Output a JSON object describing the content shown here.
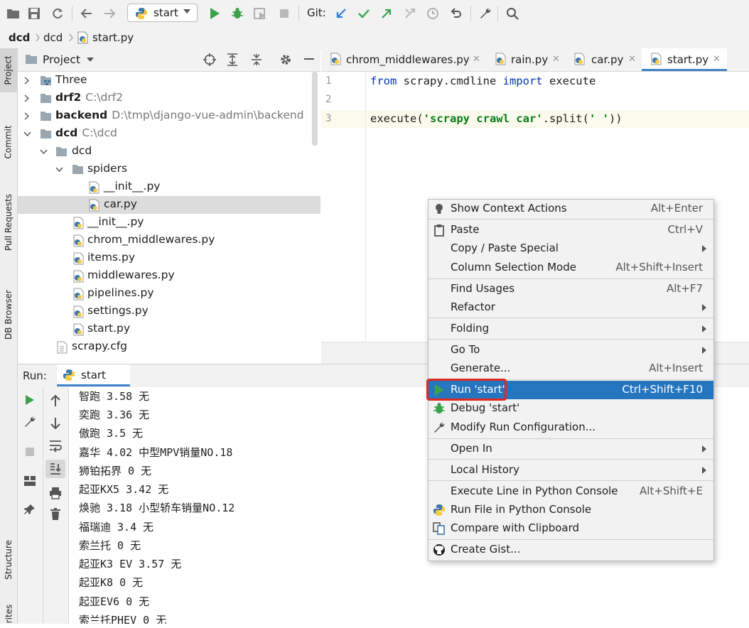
{
  "toolbar": {
    "run_config": "start",
    "git_label": "Git:"
  },
  "breadcrumb": [
    "dcd",
    "dcd",
    "start.py"
  ],
  "left_strip": [
    "Project",
    "Commit",
    "Pull Requests",
    "DB Browser",
    "Structure",
    "rites"
  ],
  "project": {
    "header": "Project",
    "tree": [
      {
        "name": "Three",
        "path": "",
        "bold": false
      },
      {
        "name": "drf2",
        "path": "C:\\drf2",
        "bold": true
      },
      {
        "name": "backend",
        "path": "D:\\tmp\\django-vue-admin\\backend",
        "bold": true
      },
      {
        "name": "dcd",
        "path": "C:\\dcd",
        "bold": true
      },
      {
        "name": "dcd",
        "path": "",
        "bold": false
      },
      {
        "name": "spiders",
        "path": "",
        "bold": false
      },
      {
        "name": "__init__.py",
        "path": "",
        "bold": false
      },
      {
        "name": "car.py",
        "path": "",
        "bold": false
      },
      {
        "name": "__init__.py",
        "path": "",
        "bold": false
      },
      {
        "name": "chrom_middlewares.py",
        "path": "",
        "bold": false
      },
      {
        "name": "items.py",
        "path": "",
        "bold": false
      },
      {
        "name": "middlewares.py",
        "path": "",
        "bold": false
      },
      {
        "name": "pipelines.py",
        "path": "",
        "bold": false
      },
      {
        "name": "settings.py",
        "path": "",
        "bold": false
      },
      {
        "name": "start.py",
        "path": "",
        "bold": false
      },
      {
        "name": "scrapy.cfg",
        "path": "",
        "bold": false
      }
    ]
  },
  "editor": {
    "tabs": [
      "chrom_middlewares.py",
      "rain.py",
      "car.py",
      "start.py"
    ],
    "active_tab": "start.py",
    "line_numbers": [
      "1",
      "2",
      "3"
    ],
    "line1": {
      "kw1": "from",
      "mod": " scrapy.cmdline ",
      "kw2": "import",
      "rest": " execute"
    },
    "line3": {
      "pre": "execute(",
      "str1": "'scrapy crawl car'",
      "mid": ".split(",
      "str2": "' '",
      "post": "))"
    }
  },
  "run": {
    "label": "Run:",
    "tab": "start",
    "output": [
      "智跑 3.58 无",
      "奕跑 3.36 无",
      "傲跑 3.5 无",
      "嘉华 4.02 中型MPV销量NO.18",
      "狮铂拓界 0 无",
      "起亚KX5 3.42 无",
      "焕驰 3.18 小型轿车销量NO.12",
      "福瑞迪 3.4 无",
      "索兰托 0 无",
      "起亚K3 EV 3.57 无",
      "起亚K8 0 无",
      "起亚EV6 0 无",
      "索兰托PHEV 0 无"
    ]
  },
  "context_menu": {
    "items": [
      {
        "label": "Show Context Actions",
        "shortcut": "Alt+Enter",
        "submenu": false,
        "icon": "bulb-icon"
      },
      {
        "label": "Paste",
        "shortcut": "Ctrl+V",
        "submenu": false,
        "icon": "clipboard-icon"
      },
      {
        "label": "Copy / Paste Special",
        "shortcut": "",
        "submenu": true,
        "icon": ""
      },
      {
        "label": "Column Selection Mode",
        "shortcut": "Alt+Shift+Insert",
        "submenu": false,
        "icon": ""
      },
      {
        "label": "Find Usages",
        "shortcut": "Alt+F7",
        "submenu": false,
        "icon": ""
      },
      {
        "label": "Refactor",
        "shortcut": "",
        "submenu": true,
        "icon": ""
      },
      {
        "label": "Folding",
        "shortcut": "",
        "submenu": true,
        "icon": ""
      },
      {
        "label": "Go To",
        "shortcut": "",
        "submenu": true,
        "icon": ""
      },
      {
        "label": "Generate...",
        "shortcut": "Alt+Insert",
        "submenu": false,
        "icon": ""
      },
      {
        "label": "Run 'start'",
        "shortcut": "Ctrl+Shift+F10",
        "submenu": false,
        "icon": "run-icon"
      },
      {
        "label": "Debug 'start'",
        "shortcut": "",
        "submenu": false,
        "icon": "debug-icon"
      },
      {
        "label": "Modify Run Configuration...",
        "shortcut": "",
        "submenu": false,
        "icon": "wrench-icon"
      },
      {
        "label": "Open In",
        "shortcut": "",
        "submenu": true,
        "icon": ""
      },
      {
        "label": "Local History",
        "shortcut": "",
        "submenu": true,
        "icon": ""
      },
      {
        "label": "Execute Line in Python Console",
        "shortcut": "Alt+Shift+E",
        "submenu": false,
        "icon": ""
      },
      {
        "label": "Run File in Python Console",
        "shortcut": "",
        "submenu": false,
        "icon": "python-icon"
      },
      {
        "label": "Compare with Clipboard",
        "shortcut": "",
        "submenu": false,
        "icon": "compare-icon"
      },
      {
        "label": "Create Gist...",
        "shortcut": "",
        "submenu": false,
        "icon": "github-icon"
      }
    ],
    "highlighted": "Run 'start'"
  },
  "colors": {
    "accent": "#2675bf",
    "run_green": "#3aa34a",
    "highlight_box": "#e3281e"
  }
}
